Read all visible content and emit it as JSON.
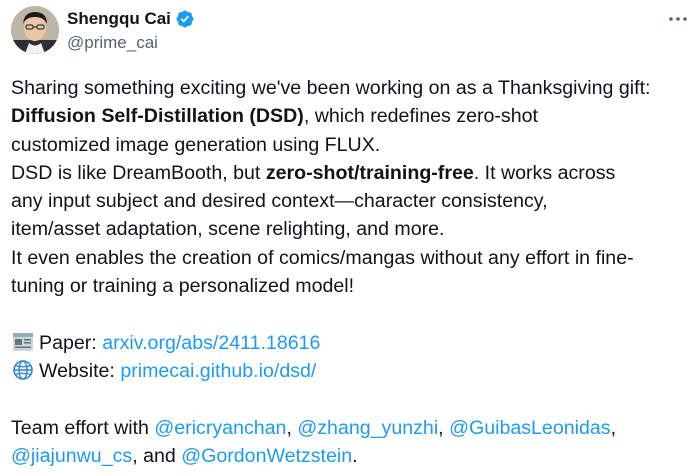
{
  "author": {
    "display_name": "Shengqu Cai",
    "handle": "@prime_cai",
    "verified_color": "#1d9bf0"
  },
  "menu_icon": "more-horizontal-icon",
  "tweet": {
    "line1": "Sharing something exciting we've been working on as a Thanksgiving gift:",
    "line2_bold": "Diffusion Self-Distillation (DSD)",
    "line2_rest": ", which redefines zero-shot",
    "line3": "customized image generation using FLUX.",
    "line4_start": "DSD is like DreamBooth, but ",
    "line4_bold": "zero-shot/training-free",
    "line4_rest": ". It works across",
    "line5": "any input subject and desired context—character consistency,",
    "line6": "item/asset adaptation, scene relighting, and more.",
    "line7": "It even enables the creation of comics/mangas without any effort in fine-",
    "line8": "tuning or training a personalized model!",
    "paper_label": "Paper: ",
    "paper_link": "arxiv.org/abs/2411.18616",
    "website_label": "Website: ",
    "website_link": "primecai.github.io/dsd/",
    "team_label": "Team effort with ",
    "mentions": [
      "@ericryanchan",
      "@zhang_yunzhi",
      "@GuibasLeonidas",
      "@jiajunwu_cs",
      "@GordonWetzstein"
    ],
    "sep_comma": ", ",
    "sep_end_comma": ",",
    "sep_and": ", and ",
    "period": "."
  },
  "colors": {
    "text": "#0f1419",
    "secondary": "#536471",
    "link": "#1d9bf0"
  }
}
